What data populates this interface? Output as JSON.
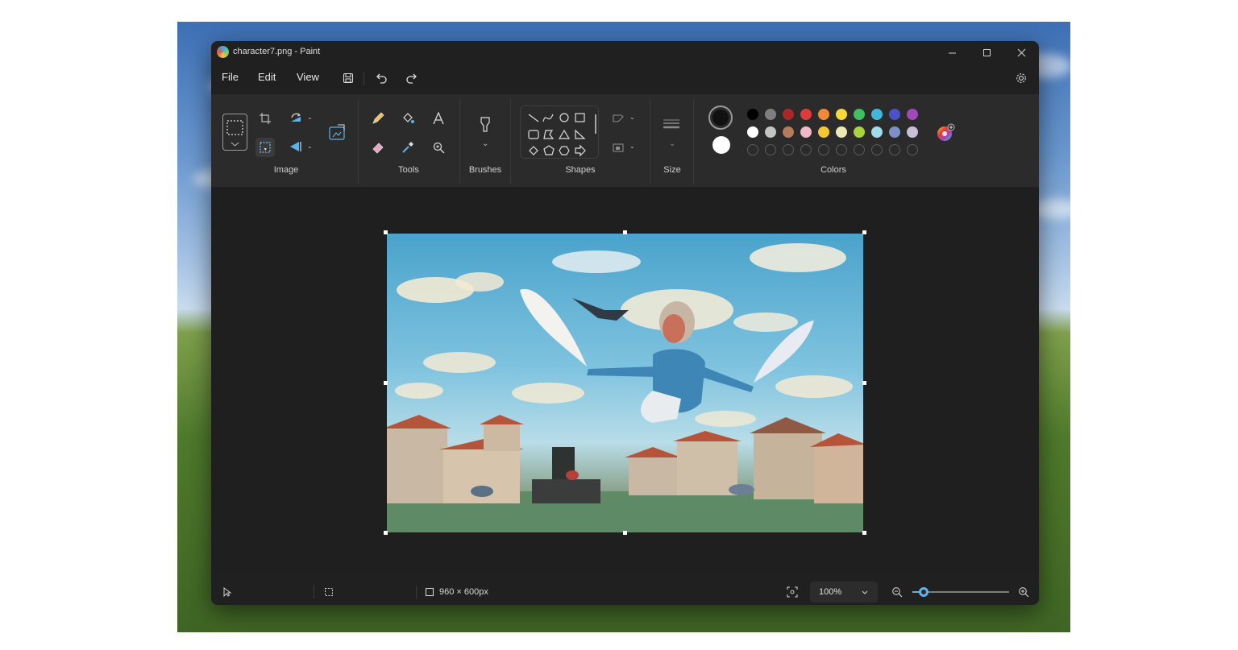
{
  "window": {
    "title": "character7.png - Paint"
  },
  "menu": {
    "file": "File",
    "edit": "Edit",
    "view": "View"
  },
  "ribbon": {
    "groups": {
      "image": "Image",
      "tools": "Tools",
      "brushes": "Brushes",
      "shapes": "Shapes",
      "size": "Size",
      "colors": "Colors"
    },
    "colors": {
      "primary": "#111111",
      "secondary": "#ffffff",
      "palette_row1": [
        "#000000",
        "#7f7f7f",
        "#a8282a",
        "#e03b3b",
        "#f08a3a",
        "#f5d83a",
        "#3fbf5f",
        "#42b6d8",
        "#4b52c8",
        "#a04ab8"
      ],
      "palette_row2": [
        "#ffffff",
        "#c3c3c3",
        "#b57b5a",
        "#f0b9c8",
        "#f5c832",
        "#eee8b4",
        "#a9d23c",
        "#9fdcea",
        "#7d91c8",
        "#c8bfd6"
      ],
      "custom_slots": 10
    }
  },
  "canvas": {
    "image_alt": "character7 artwork"
  },
  "status": {
    "dimensions": "960 × 600px",
    "zoom": "100%",
    "zoom_fraction": 0.12
  }
}
